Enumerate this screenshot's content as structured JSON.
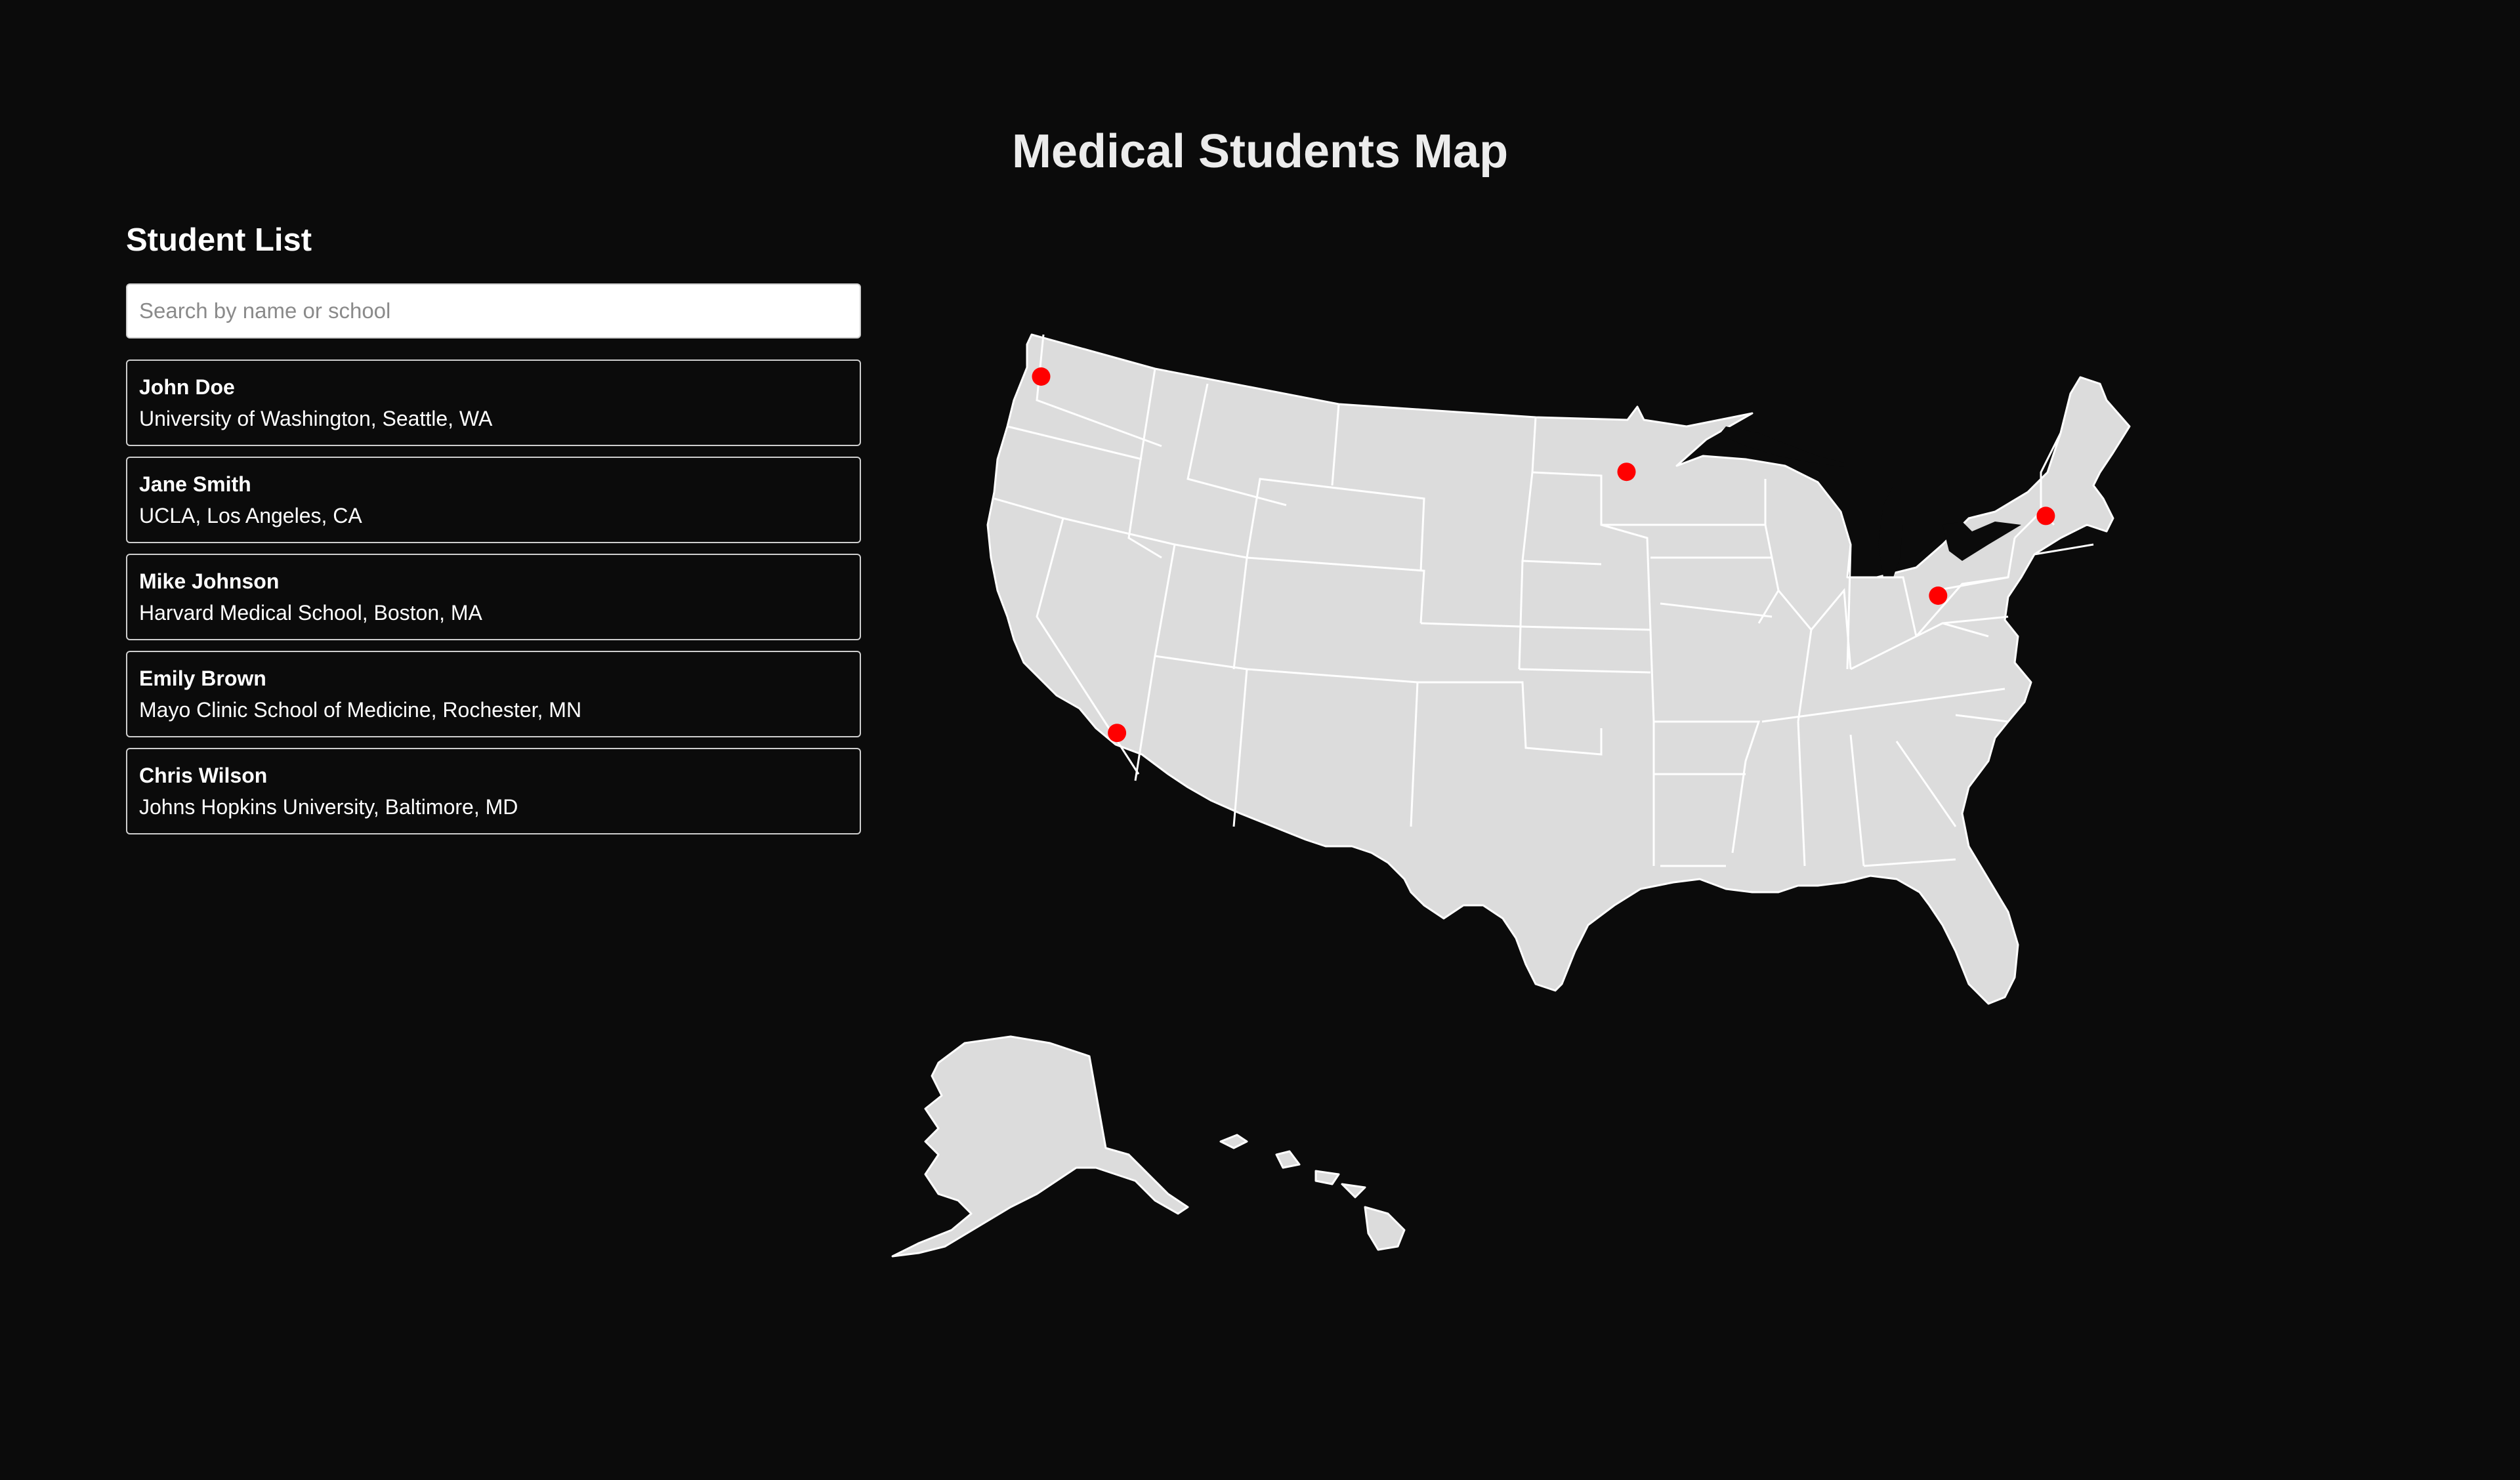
{
  "title": "Medical Students Map",
  "sidebar": {
    "heading": "Student List",
    "search_placeholder": "Search by name or school",
    "students": [
      {
        "name": "John Doe",
        "school": "University of Washington, Seattle, WA"
      },
      {
        "name": "Jane Smith",
        "school": "UCLA, Los Angeles, CA"
      },
      {
        "name": "Mike Johnson",
        "school": "Harvard Medical School, Boston, MA"
      },
      {
        "name": "Emily Brown",
        "school": "Mayo Clinic School of Medicine, Rochester, MN"
      },
      {
        "name": "Chris Wilson",
        "school": "Johns Hopkins University, Baltimore, MD"
      }
    ]
  },
  "map": {
    "region": "United States",
    "land_color": "#dcdcdc",
    "border_color": "#ffffff",
    "background_color": "#0b0b0b",
    "marker_color": "#ff0000",
    "markers": [
      {
        "student": "John Doe",
        "lat": 47.65,
        "lon": -122.31
      },
      {
        "student": "Jane Smith",
        "lat": 34.07,
        "lon": -118.44
      },
      {
        "student": "Mike Johnson",
        "lat": 42.34,
        "lon": -71.1
      },
      {
        "student": "Emily Brown",
        "lat": 44.02,
        "lon": -92.47
      },
      {
        "student": "Chris Wilson",
        "lat": 39.3,
        "lon": -76.59
      }
    ]
  }
}
